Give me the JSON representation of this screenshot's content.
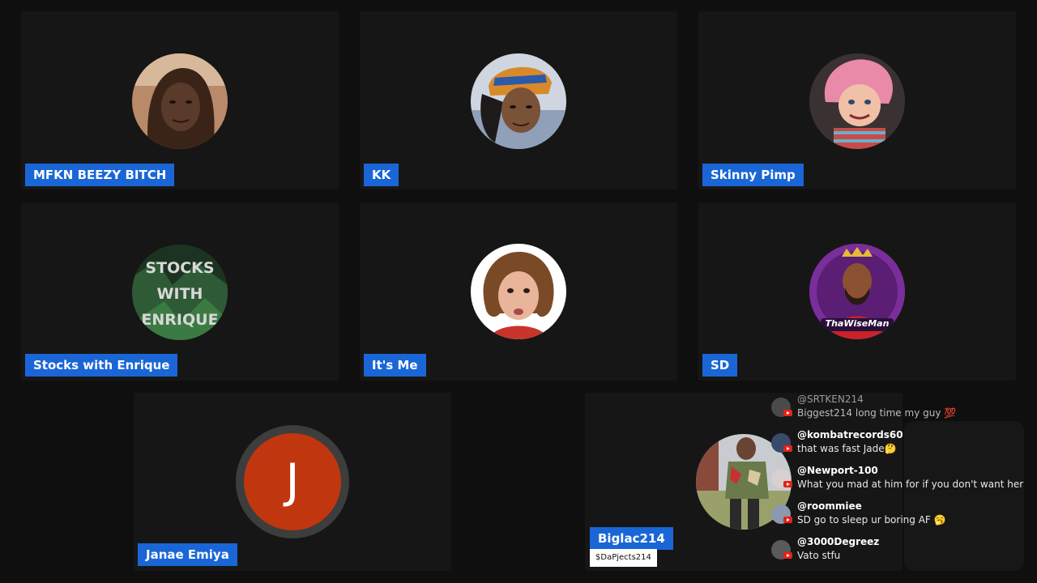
{
  "participants": [
    {
      "name": "MFKN BEEZY BITCH",
      "avatar": "woman-selfie-avatar"
    },
    {
      "name": "KK",
      "avatar": "woman-headwrap-avatar"
    },
    {
      "name": "Skinny Pimp",
      "avatar": "doll-figure-avatar"
    },
    {
      "name": "Stocks with Enrique",
      "avatar": "stocks-logo-avatar",
      "avatar_text": [
        "STOCKS",
        "WITH",
        "ENRIQUE"
      ]
    },
    {
      "name": "It's Me",
      "avatar": "woman-bob-haircut-avatar"
    },
    {
      "name": "SD",
      "avatar": "thawiseman-logo-avatar",
      "avatar_text": "ThaWiseMan"
    },
    {
      "name": "Janae Emiya",
      "initial": "J"
    },
    {
      "name": "Biglac214",
      "sub_label": "$DaPjects214",
      "avatar": "man-standing-avatar"
    }
  ],
  "chat": {
    "messages": [
      {
        "user": "@SRTKEN214",
        "text": "Biggest214 long time my guy 💯"
      },
      {
        "user": "@kombatrecords60",
        "text": "that was fast Jade🤔"
      },
      {
        "user": "@Newport-100",
        "text": "What you mad at him for if you don't want her"
      },
      {
        "user": "@roommiee",
        "text": "SD go to sleep ur boring AF 🥱"
      },
      {
        "user": "@3000Degreez",
        "text": "Vato stfu"
      }
    ]
  },
  "colors": {
    "background": "#0f0f0f",
    "tile": "#161616",
    "name_tag": "#1a66d6",
    "initial_avatar": "#c0360f",
    "youtube_badge": "#e62117"
  }
}
